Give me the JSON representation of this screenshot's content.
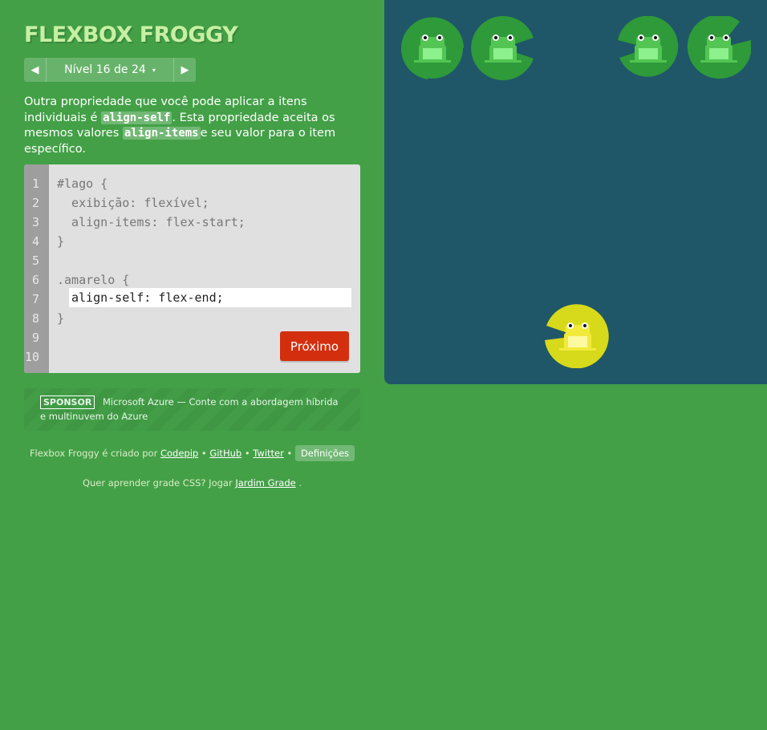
{
  "game": {
    "title": "FLEXBOX FROGGY"
  },
  "level_nav": {
    "prev_icon": "triangle-left-icon",
    "next_icon": "triangle-right-icon",
    "label": "Nível 16 de 24",
    "caret": "▾"
  },
  "instructions": {
    "part1": "Outra propriedade que você pode aplicar a itens individuais é ",
    "code1": "align-self",
    "part2": ". Esta propriedade aceita os mesmos valores ",
    "code2": "align-items",
    "part3": "e seu valor para o item específico."
  },
  "editor": {
    "line_numbers": [
      "1",
      "2",
      "3",
      "4",
      "5",
      "6",
      "7",
      "8",
      "9",
      "10"
    ],
    "lines": [
      "#lago {",
      "  exibição: flexível;",
      "  align-items: flex-start;",
      "}",
      "",
      ".amarelo {",
      "",
      "}"
    ],
    "input_value": "align-self: flex-end;",
    "next_label": "Próximo"
  },
  "sponsor": {
    "badge": "SPONSOR",
    "text": "Microsoft Azure — Conte com a abordagem híbrida e multinuvem do Azure"
  },
  "footer": {
    "credit_prefix": "Flexbox Froggy é criado por ",
    "codepip": "Codepip",
    "sep1": " • ",
    "github": "GitHub",
    "sep2": " • ",
    "twitter": "Twitter",
    "sep3": " • ",
    "settings": "Definições",
    "grid_prefix": "Quer aprender grade CSS? Jogar ",
    "grid_link": "Jardim Grade",
    "grid_suffix": " ."
  },
  "board": {
    "colors": {
      "water": "#1f5768",
      "green_pad": "#2e9a3a",
      "green_frog": "#6fd86f",
      "yellow_pad": "#d7d91b",
      "yellow_frog": "#fbf67d"
    },
    "lilypads": [
      {
        "color": "green",
        "icon": "lilypad-green-icon"
      },
      {
        "color": "green",
        "icon": "lilypad-green-icon"
      },
      {
        "color": "green",
        "icon": "lilypad-green-icon"
      },
      {
        "color": "green",
        "icon": "lilypad-green-icon"
      },
      {
        "color": "yellow",
        "icon": "lilypad-yellow-icon"
      }
    ]
  }
}
